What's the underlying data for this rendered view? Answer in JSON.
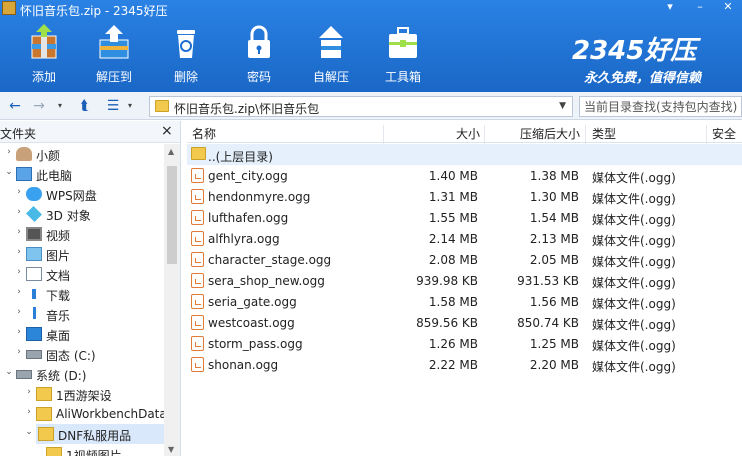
{
  "window": {
    "title": "怀旧音乐包.zip - 2345好压"
  },
  "toolbar": {
    "items": [
      {
        "label": "添加",
        "icon": "add-archive-icon"
      },
      {
        "label": "解压到",
        "icon": "extract-to-icon"
      },
      {
        "label": "删除",
        "icon": "delete-icon"
      },
      {
        "label": "密码",
        "icon": "lock-icon"
      },
      {
        "label": "自解压",
        "icon": "self-extract-icon"
      },
      {
        "label": "工具箱",
        "icon": "toolbox-icon"
      }
    ]
  },
  "brand": {
    "name": "2345好压",
    "slogan": "永久免费，值得信赖"
  },
  "address": {
    "path": "怀旧音乐包.zip\\怀旧音乐包",
    "search_placeholder": "当前目录查找(支持包内查找)"
  },
  "left_pane": {
    "title": "文件夹",
    "close": "×",
    "items": [
      {
        "label": "小颜",
        "icon": "user-icon",
        "arrow": "›",
        "indent": 0
      },
      {
        "label": "此电脑",
        "icon": "computer-icon",
        "arrow": "⌄",
        "indent": 0
      },
      {
        "label": "WPS网盘",
        "icon": "cloud-icon",
        "arrow": "›",
        "indent": 1
      },
      {
        "label": "3D 对象",
        "icon": "cube-icon",
        "arrow": "›",
        "indent": 1
      },
      {
        "label": "视频",
        "icon": "video-icon",
        "arrow": "›",
        "indent": 1
      },
      {
        "label": "图片",
        "icon": "picture-icon",
        "arrow": "›",
        "indent": 1
      },
      {
        "label": "文档",
        "icon": "document-icon",
        "arrow": "›",
        "indent": 1
      },
      {
        "label": "下载",
        "icon": "download-icon",
        "arrow": "›",
        "indent": 1
      },
      {
        "label": "音乐",
        "icon": "music-icon",
        "arrow": "›",
        "indent": 1
      },
      {
        "label": "桌面",
        "icon": "desktop-icon",
        "arrow": "›",
        "indent": 1
      },
      {
        "label": "固态 (C:)",
        "icon": "drive-icon",
        "arrow": "›",
        "indent": 1
      },
      {
        "label": "系统 (D:)",
        "icon": "drive-icon",
        "arrow": "⌄",
        "indent": 0
      },
      {
        "label": "1西游架设",
        "icon": "folder-icon",
        "arrow": "›",
        "indent": 2
      },
      {
        "label": "AliWorkbenchData",
        "icon": "folder-icon",
        "arrow": "›",
        "indent": 2
      },
      {
        "label": "DNF私服用品",
        "icon": "folder-icon",
        "arrow": "⌄",
        "indent": 2,
        "selected": true
      },
      {
        "label": "1视频图片",
        "icon": "folder-icon",
        "arrow": "",
        "indent": 3
      }
    ]
  },
  "columns": {
    "name": "名称",
    "size": "大小",
    "compressed": "压缩后大小",
    "type": "类型",
    "security": "安全"
  },
  "files": [
    {
      "name": "..(上层目录)",
      "size": "",
      "compressed": "",
      "type": "",
      "parent": true
    },
    {
      "name": "gent_city.ogg",
      "size": "1.40 MB",
      "compressed": "1.38 MB",
      "type": "媒体文件(.ogg)"
    },
    {
      "name": "hendonmyre.ogg",
      "size": "1.31 MB",
      "compressed": "1.30 MB",
      "type": "媒体文件(.ogg)"
    },
    {
      "name": "lufthafen.ogg",
      "size": "1.55 MB",
      "compressed": "1.54 MB",
      "type": "媒体文件(.ogg)"
    },
    {
      "name": "alfhlyra.ogg",
      "size": "2.14 MB",
      "compressed": "2.13 MB",
      "type": "媒体文件(.ogg)"
    },
    {
      "name": "character_stage.ogg",
      "size": "2.08 MB",
      "compressed": "2.05 MB",
      "type": "媒体文件(.ogg)"
    },
    {
      "name": "sera_shop_new.ogg",
      "size": "939.98 KB",
      "compressed": "931.53 KB",
      "type": "媒体文件(.ogg)"
    },
    {
      "name": "seria_gate.ogg",
      "size": "1.58 MB",
      "compressed": "1.56 MB",
      "type": "媒体文件(.ogg)"
    },
    {
      "name": "westcoast.ogg",
      "size": "859.56 KB",
      "compressed": "850.74 KB",
      "type": "媒体文件(.ogg)"
    },
    {
      "name": "storm_pass.ogg",
      "size": "1.26 MB",
      "compressed": "1.25 MB",
      "type": "媒体文件(.ogg)"
    },
    {
      "name": "shonan.ogg",
      "size": "2.22 MB",
      "compressed": "2.20 MB",
      "type": "媒体文件(.ogg)"
    }
  ],
  "colors": {
    "banner": "#1e6fd0",
    "folder": "#f2c94c",
    "audio_icon": "#e07b39",
    "selection": "#d9e8fb"
  }
}
